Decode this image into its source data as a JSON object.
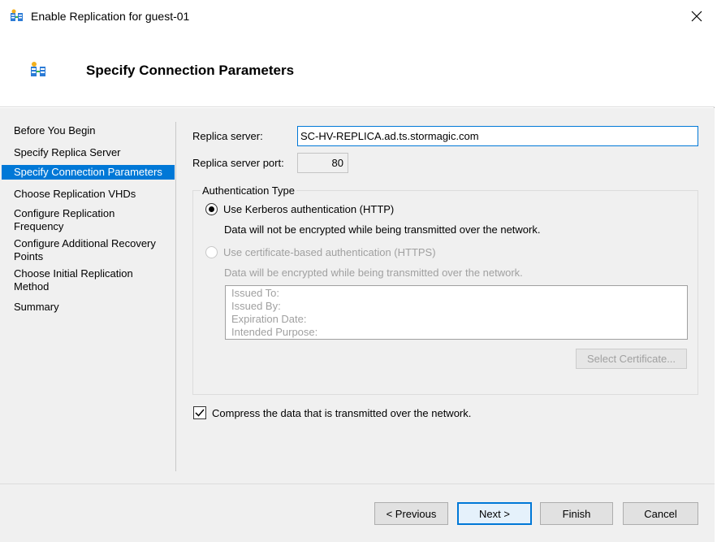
{
  "window": {
    "title": "Enable Replication for guest-01"
  },
  "header": {
    "title": "Specify Connection Parameters"
  },
  "nav": {
    "items": [
      {
        "label": "Before You Begin"
      },
      {
        "label": "Specify Replica Server"
      },
      {
        "label": "Specify Connection Parameters",
        "selected": true
      },
      {
        "label": "Choose Replication VHDs"
      },
      {
        "label": "Configure Replication Frequency"
      },
      {
        "label": "Configure Additional Recovery Points"
      },
      {
        "label": "Choose Initial Replication Method"
      },
      {
        "label": "Summary"
      }
    ]
  },
  "form": {
    "replica_server_label": "Replica server:",
    "replica_server_value": "SC-HV-REPLICA.ad.ts.stormagic.com",
    "replica_port_label": "Replica server port:",
    "replica_port_value": "80",
    "auth_group_label": "Authentication Type",
    "kerberos_label": "Use Kerberos authentication (HTTP)",
    "kerberos_note": "Data will not be encrypted while being transmitted over the network.",
    "cert_label": "Use certificate-based authentication (HTTPS)",
    "cert_note": "Data will be encrypted while being transmitted over the network.",
    "cert_fields": [
      "Issued To:",
      "Issued By:",
      "Expiration Date:",
      "Intended Purpose:"
    ],
    "select_cert_label": "Select Certificate...",
    "compress_label": "Compress the data that is transmitted over the network.",
    "compress_checked": true,
    "kerberos_selected": true
  },
  "footer": {
    "previous_label": "< Previous",
    "next_label": "Next >",
    "finish_label": "Finish",
    "cancel_label": "Cancel"
  },
  "colors": {
    "accent": "#0078d7",
    "body_bg": "#f0f0f0",
    "disabled_text": "#a0a0a0"
  }
}
